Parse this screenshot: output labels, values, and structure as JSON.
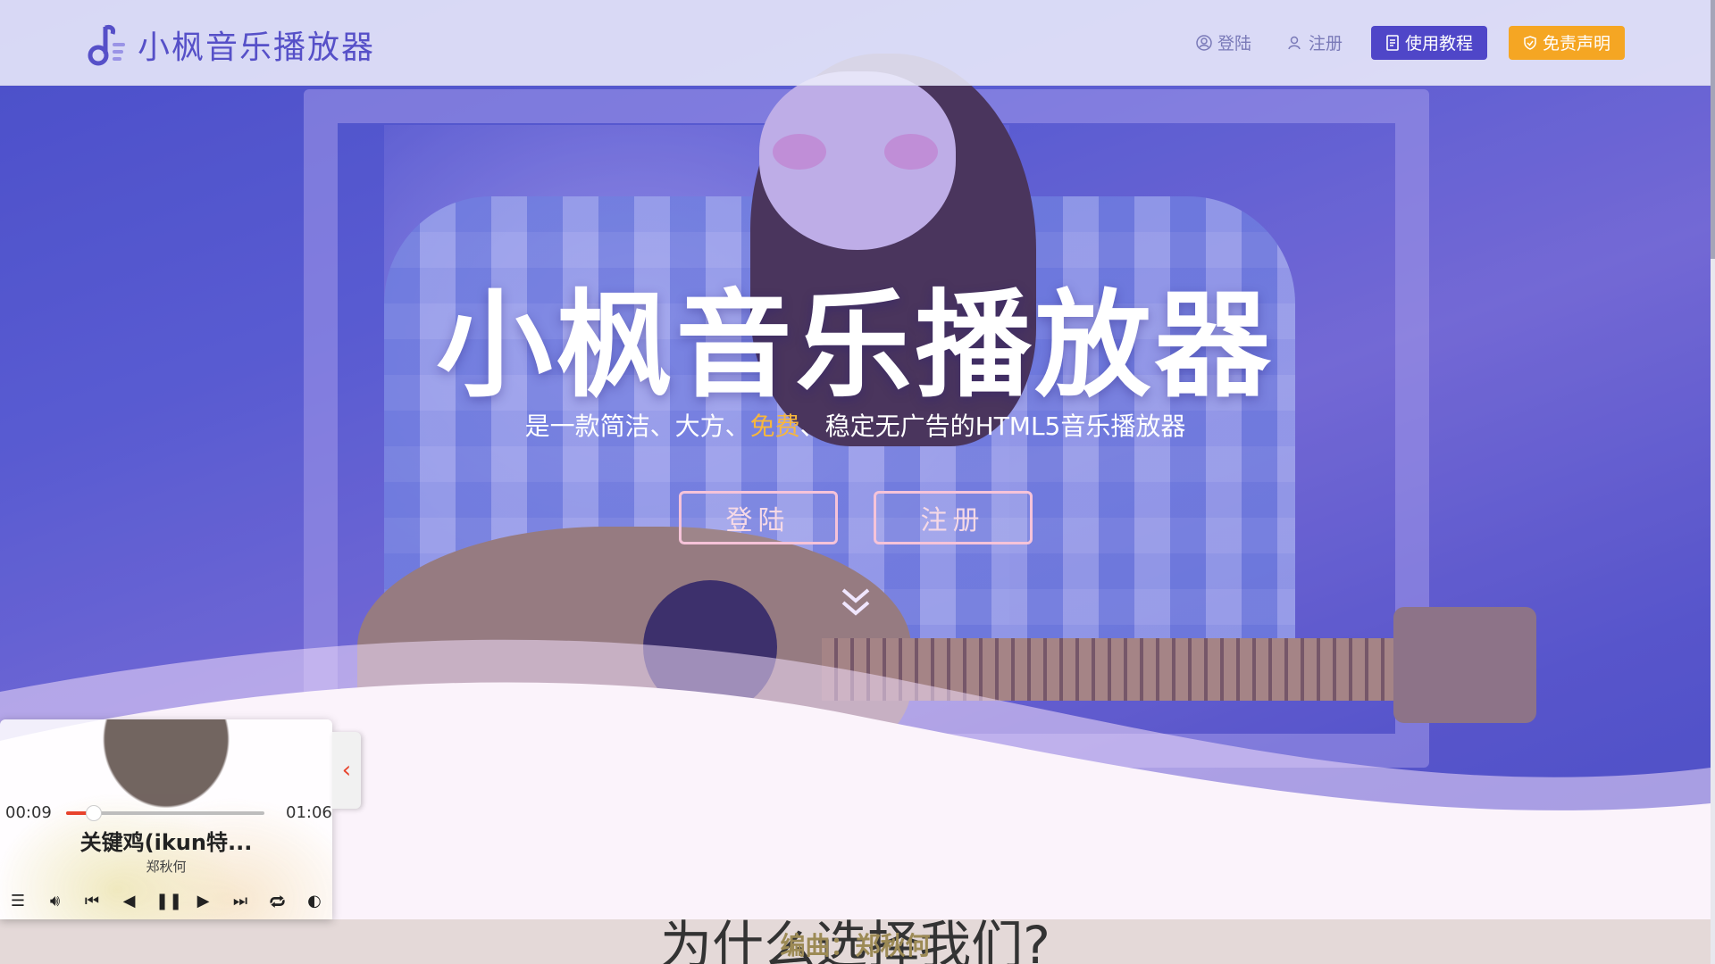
{
  "header": {
    "logo_text": "小枫音乐播放器",
    "nav_login": "登陆",
    "nav_register": "注册",
    "btn_tutorial": "使用教程",
    "btn_disclaimer": "免责声明"
  },
  "hero": {
    "title": "小枫音乐播放器",
    "subtitle_part1": "是一款简洁、大方、",
    "subtitle_highlight": "免费",
    "subtitle_part2": "、稳定无广告的HTML5音乐播放器",
    "btn_login": "登陆",
    "btn_register": "注册"
  },
  "section": {
    "title": "为什么选择我们?"
  },
  "lyric": "编曲：郑秋何",
  "player": {
    "time_current": "00:09",
    "time_total": "01:06",
    "progress_fraction": 0.14,
    "song_title": "关键鸡(ikun特...",
    "artist": "郑秋何"
  },
  "colors": {
    "brand": "#5650c8",
    "tutorial_button": "#4f46c8",
    "disclaimer_button": "#f5a623",
    "highlight": "#f8b73c",
    "progress": "#e8432c"
  }
}
